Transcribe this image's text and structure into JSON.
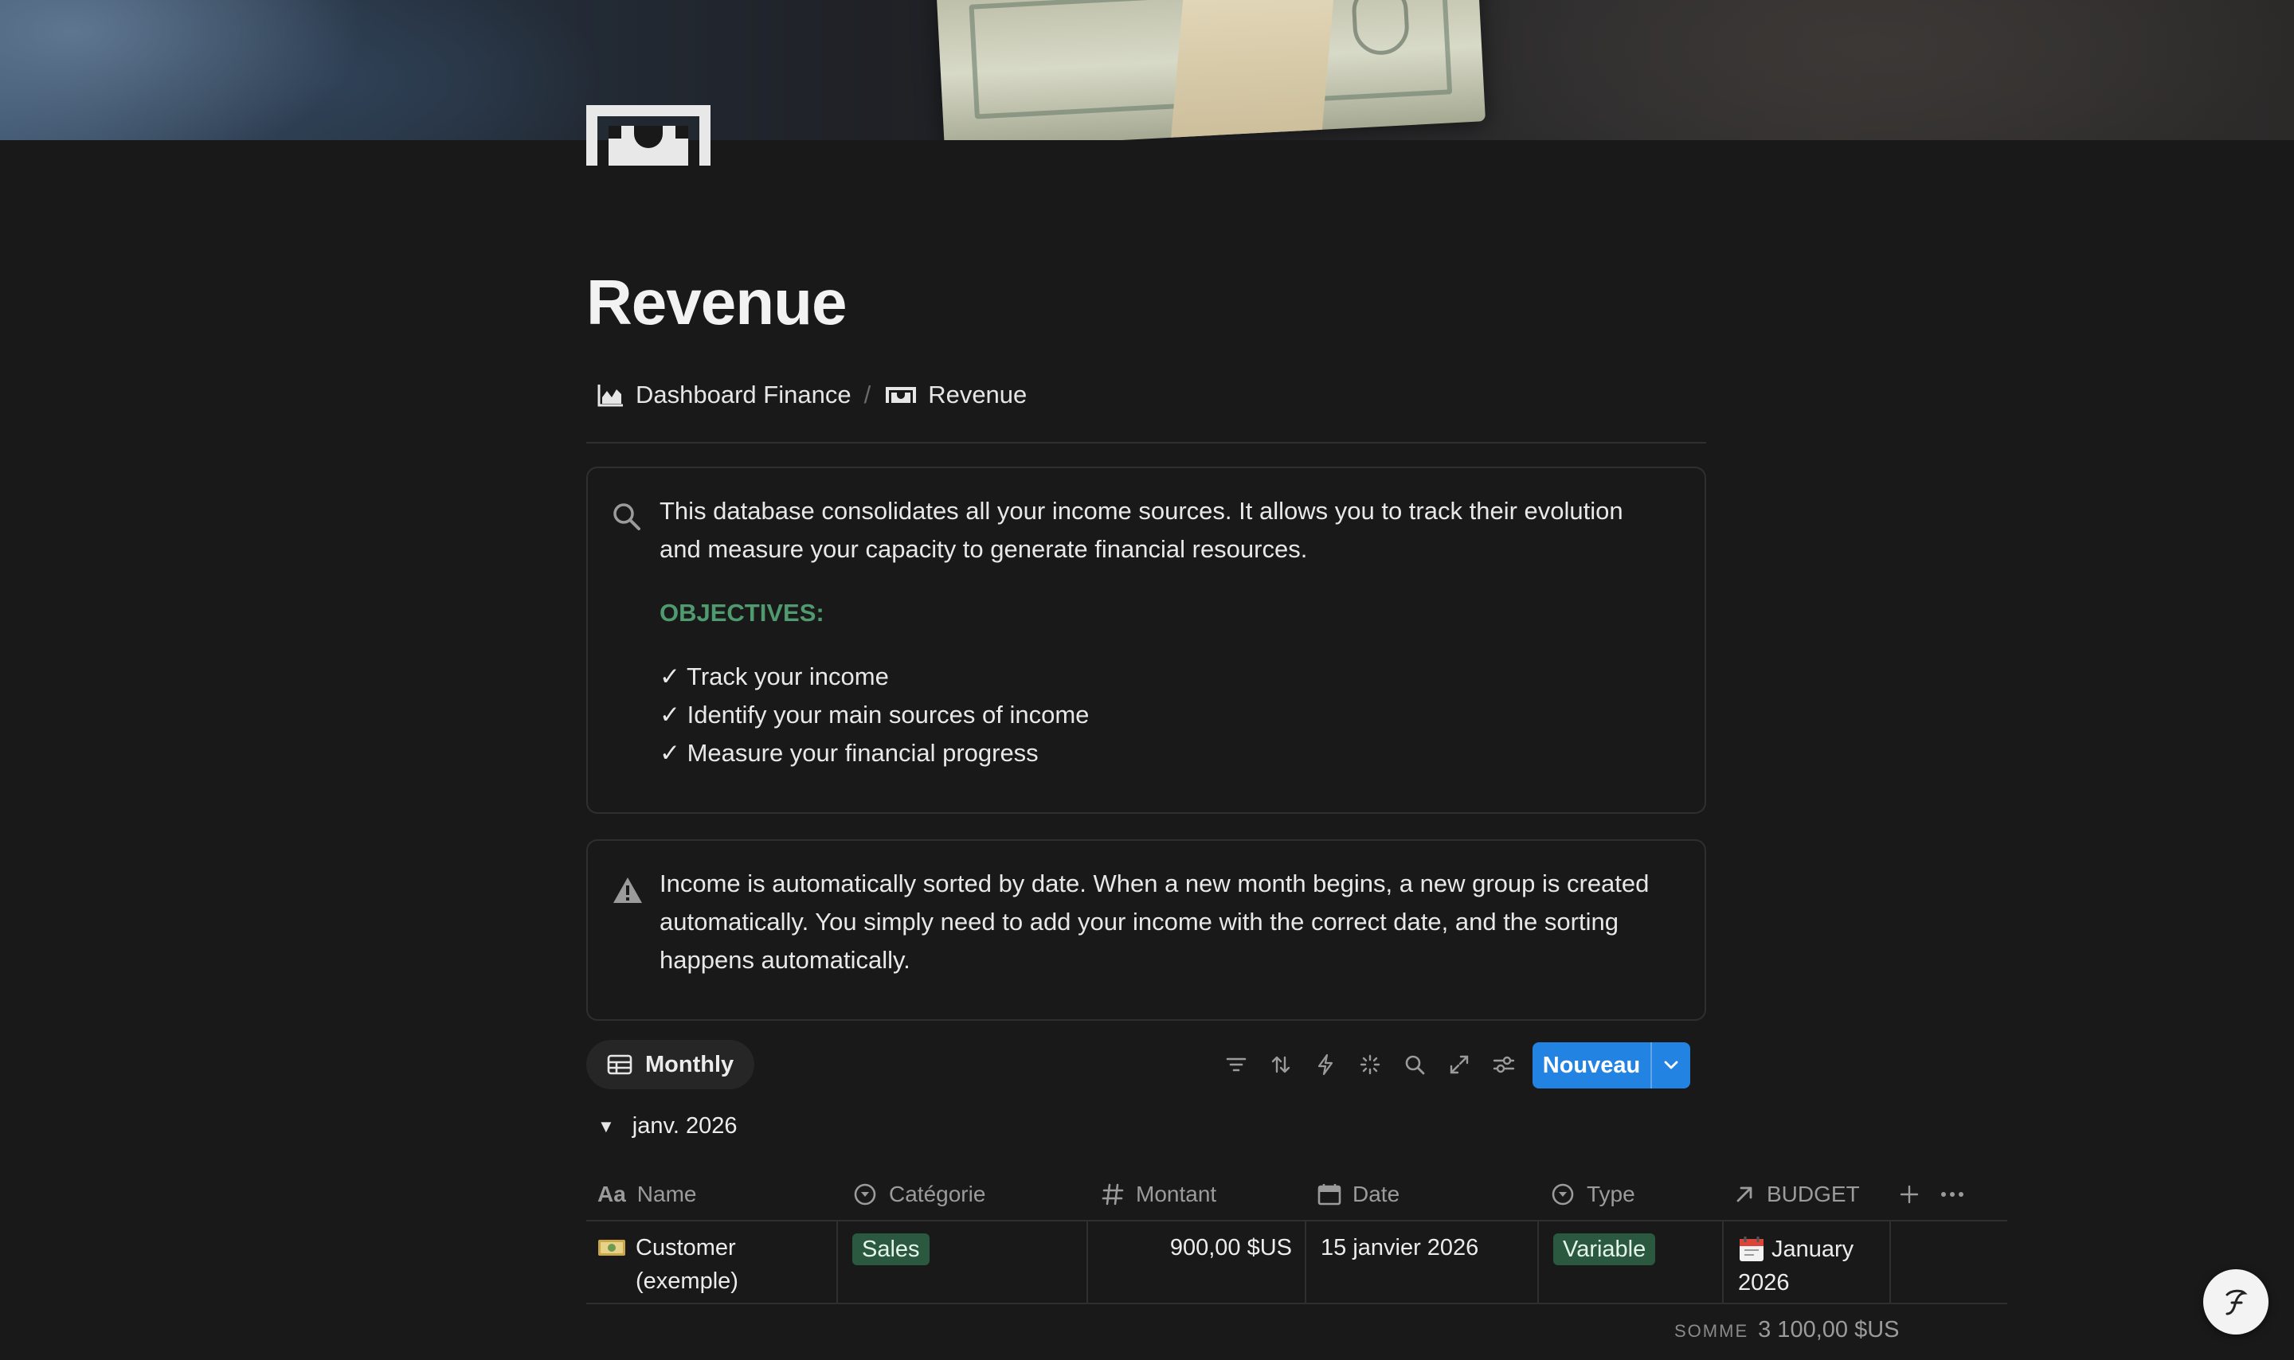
{
  "page": {
    "title": "Revenue"
  },
  "breadcrumb": {
    "items": [
      {
        "label": "Dashboard Finance",
        "icon": "chart-icon"
      },
      {
        "label": "Revenue",
        "icon": "money-icon"
      }
    ],
    "separator": "/"
  },
  "callout_info": {
    "icon": "search-icon",
    "text": "This database consolidates all your income sources. It allows you to track their evolution and measure your capacity to generate financial resources.",
    "objectives_title": "OBJECTIVES:",
    "objectives": [
      "✓ Track your income",
      "✓ Identify your main sources of income",
      "✓ Measure your financial progress"
    ],
    "objectives_color": "#4f9a6f"
  },
  "callout_warning": {
    "icon": "warning-icon",
    "text": "Income is automatically sorted by date. When a new month begins, a new group is created automatically. You simply need to add your income with the correct date, and the sorting happens automatically."
  },
  "toolbar": {
    "view_label": "Monthly",
    "tools": [
      "filter-icon",
      "sort-icon",
      "automation-icon",
      "ai-sparkle-icon",
      "search-icon",
      "expand-icon",
      "settings-icon"
    ],
    "new_label": "Nouveau",
    "new_color": "#2383e2"
  },
  "group": {
    "label": "janv. 2026"
  },
  "table": {
    "columns": [
      {
        "label": "Name",
        "icon": "text-property-icon"
      },
      {
        "label": "Catégorie",
        "icon": "select-property-icon"
      },
      {
        "label": "Montant",
        "icon": "number-property-icon"
      },
      {
        "label": "Date",
        "icon": "calendar-property-icon"
      },
      {
        "label": "Type",
        "icon": "select-property-icon"
      },
      {
        "label": "BUDGET",
        "icon": "relation-property-icon"
      }
    ],
    "rows": [
      {
        "name_line1": "Customer",
        "name_line2": "(exemple)",
        "name_icon": "money-bill-emoji",
        "category": "Sales",
        "amount": "900,00 $US",
        "date": "15 janvier 2026",
        "type": "Variable",
        "budget_line1": "January",
        "budget_line2": "2026",
        "budget_icon": "calendar-emoji"
      }
    ],
    "sum_label": "SOMME",
    "sum_value": "3 100,00 $US"
  }
}
